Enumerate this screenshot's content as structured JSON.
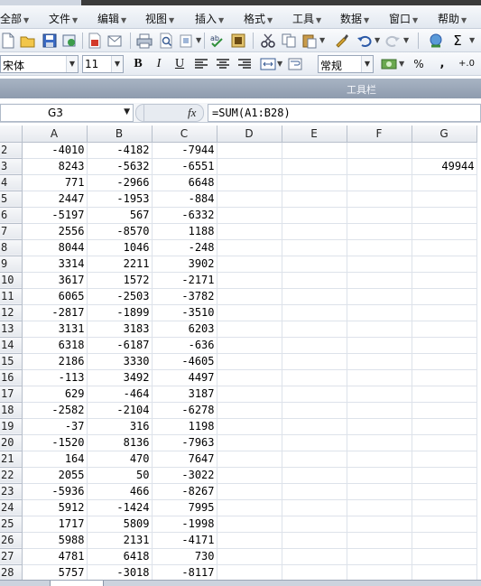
{
  "menu": {
    "items": [
      {
        "label": "全部"
      },
      {
        "label": "文件"
      },
      {
        "label": "编辑"
      },
      {
        "label": "视图"
      },
      {
        "label": "插入"
      },
      {
        "label": "格式"
      },
      {
        "label": "工具"
      },
      {
        "label": "数据"
      },
      {
        "label": "窗口"
      },
      {
        "label": "帮助"
      }
    ]
  },
  "toolbar": {
    "font_name": "宋体",
    "font_size": "11",
    "bold": "B",
    "italic": "I",
    "underline": "U",
    "number_format": "常规",
    "percent": "%",
    "comma": ",",
    "increase_decimal": "+.0",
    "sigma": "Σ"
  },
  "titlebar": {
    "title": "工具栏"
  },
  "formula_bar": {
    "cell_ref": "G3",
    "fx": "fx",
    "formula": "=SUM(A1:B28)"
  },
  "sheet": {
    "columns": [
      "A",
      "B",
      "C",
      "D",
      "E",
      "F",
      "G"
    ],
    "rows": [
      {
        "n": "2",
        "A": "-4010",
        "B": "-4182",
        "C": "-7944",
        "G": ""
      },
      {
        "n": "3",
        "A": "8243",
        "B": "-5632",
        "C": "-6551",
        "G": "49944"
      },
      {
        "n": "4",
        "A": "771",
        "B": "-2966",
        "C": "6648",
        "G": ""
      },
      {
        "n": "5",
        "A": "2447",
        "B": "-1953",
        "C": "-884",
        "G": ""
      },
      {
        "n": "6",
        "A": "-5197",
        "B": "567",
        "C": "-6332",
        "G": ""
      },
      {
        "n": "7",
        "A": "2556",
        "B": "-8570",
        "C": "1188",
        "G": ""
      },
      {
        "n": "8",
        "A": "8044",
        "B": "1046",
        "C": "-248",
        "G": ""
      },
      {
        "n": "9",
        "A": "3314",
        "B": "2211",
        "C": "3902",
        "G": ""
      },
      {
        "n": "10",
        "A": "3617",
        "B": "1572",
        "C": "-2171",
        "G": ""
      },
      {
        "n": "11",
        "A": "6065",
        "B": "-2503",
        "C": "-3782",
        "G": ""
      },
      {
        "n": "12",
        "A": "-2817",
        "B": "-1899",
        "C": "-3510",
        "G": ""
      },
      {
        "n": "13",
        "A": "3131",
        "B": "3183",
        "C": "6203",
        "G": ""
      },
      {
        "n": "14",
        "A": "6318",
        "B": "-6187",
        "C": "-636",
        "G": ""
      },
      {
        "n": "15",
        "A": "2186",
        "B": "3330",
        "C": "-4605",
        "G": ""
      },
      {
        "n": "16",
        "A": "-113",
        "B": "3492",
        "C": "4497",
        "G": ""
      },
      {
        "n": "17",
        "A": "629",
        "B": "-464",
        "C": "3187",
        "G": ""
      },
      {
        "n": "18",
        "A": "-2582",
        "B": "-2104",
        "C": "-6278",
        "G": ""
      },
      {
        "n": "19",
        "A": "-37",
        "B": "316",
        "C": "1198",
        "G": ""
      },
      {
        "n": "20",
        "A": "-1520",
        "B": "8136",
        "C": "-7963",
        "G": ""
      },
      {
        "n": "21",
        "A": "164",
        "B": "470",
        "C": "7647",
        "G": ""
      },
      {
        "n": "22",
        "A": "2055",
        "B": "50",
        "C": "-3022",
        "G": ""
      },
      {
        "n": "23",
        "A": "-5936",
        "B": "466",
        "C": "-8267",
        "G": ""
      },
      {
        "n": "24",
        "A": "5912",
        "B": "-1424",
        "C": "7995",
        "G": ""
      },
      {
        "n": "25",
        "A": "1717",
        "B": "5809",
        "C": "-1998",
        "G": ""
      },
      {
        "n": "26",
        "A": "5988",
        "B": "2131",
        "C": "-4171",
        "G": ""
      },
      {
        "n": "27",
        "A": "4781",
        "B": "6418",
        "C": "730",
        "G": ""
      },
      {
        "n": "28",
        "A": "5757",
        "B": "-3018",
        "C": "-8117",
        "G": ""
      }
    ]
  },
  "colors": {
    "menubar": "#e2e8f0",
    "titlebar": "#8e9bae",
    "grid_line": "#dde2ea",
    "header_bg": "#e6e9ee"
  }
}
